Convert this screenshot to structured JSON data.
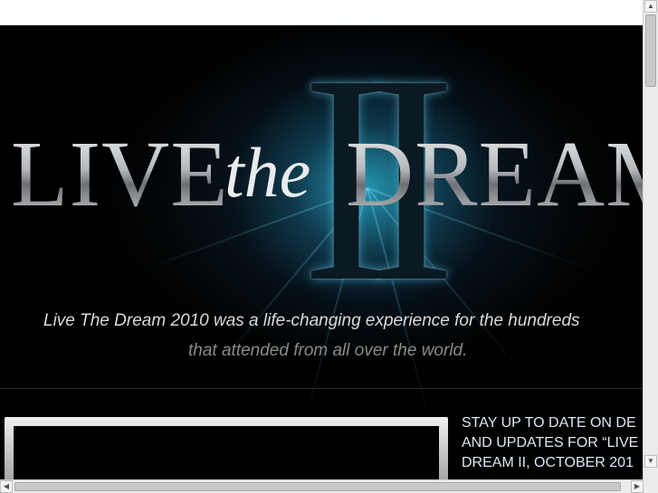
{
  "hero": {
    "numeral": "II",
    "title_live": "LIVE",
    "title_the": "the",
    "title_dream": "DREAM",
    "tagline_line1": "Live The Dream 2010 was a life-changing experience for the hundreds",
    "tagline_line2": "that attended from all over the world."
  },
  "signup": {
    "line1": "STAY UP TO DATE ON DE",
    "line2": "AND UPDATES FOR “LIVE",
    "line3": "DREAM II, OCTOBER 201"
  },
  "scrollbars": {
    "up_arrow": "▲",
    "down_arrow": "▼",
    "left_arrow": "◀",
    "right_arrow": "▶"
  },
  "colors": {
    "page_background": "#000000",
    "glow": "#28aac8",
    "signup_text": "#dde6f2"
  },
  "icons": [
    "scroll-up-icon",
    "scroll-down-icon",
    "scroll-left-icon",
    "scroll-right-icon"
  ]
}
